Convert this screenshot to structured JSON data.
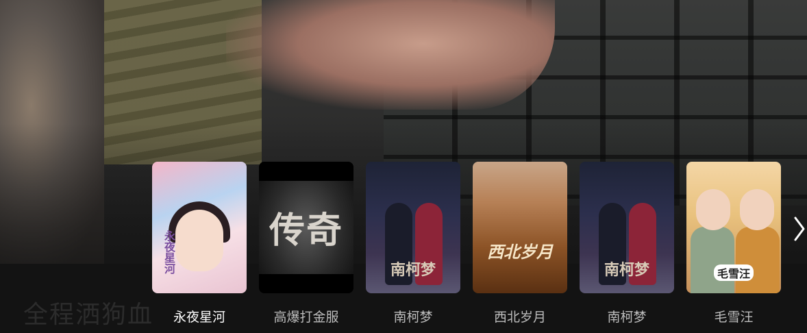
{
  "hero": {
    "title": "全程洒狗血"
  },
  "carousel": {
    "items": [
      {
        "title": "永夜星河",
        "poster_text": "永夜星河",
        "active": true
      },
      {
        "title": "高爆打金服",
        "poster_text": "传奇",
        "active": false
      },
      {
        "title": "南柯梦",
        "poster_text": "南柯梦",
        "active": false
      },
      {
        "title": "西北岁月",
        "poster_text": "西北岁月",
        "active": false
      },
      {
        "title": "南柯梦",
        "poster_text": "南柯梦",
        "active": false
      },
      {
        "title": "毛雪汪",
        "poster_text": "毛雪汪",
        "active": false
      }
    ],
    "next_icon": "chevron-right-icon"
  },
  "colors": {
    "active_label": "#ffffff",
    "inactive_label": "#bdbdbd",
    "bar_background": "#141414"
  }
}
